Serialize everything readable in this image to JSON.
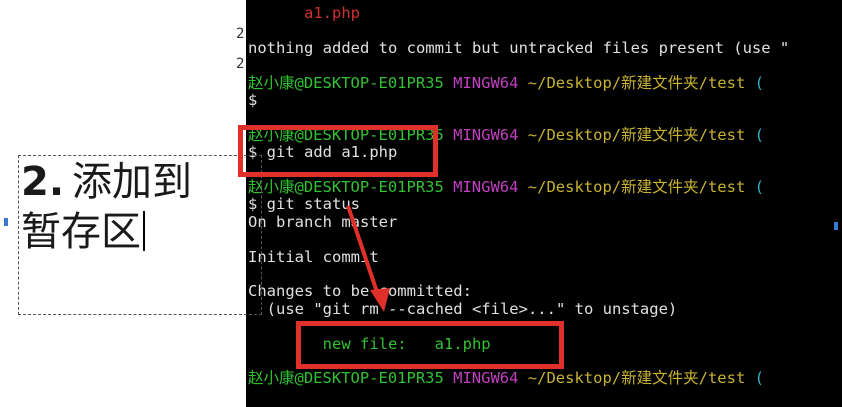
{
  "slide": {
    "gutter_digits": [
      "2",
      "2"
    ],
    "heading_number": "2.",
    "heading_line1": "添加到",
    "heading_line2": "暂存区"
  },
  "terminal": {
    "lines": [
      {
        "segments": [
          {
            "text": "      a1.php",
            "color": "red"
          }
        ]
      },
      {
        "segments": [
          {
            "text": "",
            "color": "white"
          }
        ]
      },
      {
        "segments": [
          {
            "text": "nothing added to commit but untracked files present (use \"",
            "color": "white"
          }
        ]
      },
      {
        "segments": [
          {
            "text": "",
            "color": "white"
          }
        ]
      },
      {
        "segments": [
          {
            "text": "赵小康@DESKTOP-E01PR35",
            "color": "green"
          },
          {
            "text": " MINGW64",
            "color": "magenta"
          },
          {
            "text": " ~/Desktop/新建文件夹/test",
            "color": "yellow"
          },
          {
            "text": " (",
            "color": "cyan"
          }
        ]
      },
      {
        "segments": [
          {
            "text": "$",
            "color": "white"
          }
        ]
      },
      {
        "segments": [
          {
            "text": "",
            "color": "white"
          }
        ]
      },
      {
        "segments": [
          {
            "text": "赵小康@DESKTOP-E01PR35",
            "color": "green"
          },
          {
            "text": " MINGW64",
            "color": "magenta"
          },
          {
            "text": " ~/Desktop/新建文件夹/test",
            "color": "yellow"
          },
          {
            "text": " (",
            "color": "cyan"
          }
        ]
      },
      {
        "segments": [
          {
            "text": "$ git add a1.php",
            "color": "white"
          }
        ]
      },
      {
        "segments": [
          {
            "text": "",
            "color": "white"
          }
        ]
      },
      {
        "segments": [
          {
            "text": "赵小康@DESKTOP-E01PR35",
            "color": "green"
          },
          {
            "text": " MINGW64",
            "color": "magenta"
          },
          {
            "text": " ~/Desktop/新建文件夹/test",
            "color": "yellow"
          },
          {
            "text": " (",
            "color": "cyan"
          }
        ]
      },
      {
        "segments": [
          {
            "text": "$ git status",
            "color": "white"
          }
        ]
      },
      {
        "segments": [
          {
            "text": "On branch master",
            "color": "white"
          }
        ]
      },
      {
        "segments": [
          {
            "text": "",
            "color": "white"
          }
        ]
      },
      {
        "segments": [
          {
            "text": "Initial commit",
            "color": "white"
          }
        ]
      },
      {
        "segments": [
          {
            "text": "",
            "color": "white"
          }
        ]
      },
      {
        "segments": [
          {
            "text": "Changes to be committed:",
            "color": "white"
          }
        ]
      },
      {
        "segments": [
          {
            "text": "  (use \"git rm --cached <file>...\" to unstage)",
            "color": "white"
          }
        ]
      },
      {
        "segments": [
          {
            "text": "",
            "color": "white"
          }
        ]
      },
      {
        "segments": [
          {
            "text": "        new file:   a1.php",
            "color": "green"
          }
        ]
      },
      {
        "segments": [
          {
            "text": "",
            "color": "white"
          }
        ]
      },
      {
        "segments": [
          {
            "text": "赵小康@DESKTOP-E01PR35",
            "color": "green"
          },
          {
            "text": " MINGW64",
            "color": "magenta"
          },
          {
            "text": " ~/Desktop/新建文件夹/test",
            "color": "yellow"
          },
          {
            "text": " (",
            "color": "cyan"
          }
        ]
      }
    ]
  },
  "colors": {
    "terminal_bg": "#000000",
    "annotation_red": "#e0302a",
    "prompt_green": "#31c231",
    "prompt_magenta": "#c040c0",
    "prompt_yellow": "#c8b232",
    "untracked_red": "#d03030"
  },
  "icons": {
    "annotation_arrow": "red-arrow-icon"
  }
}
